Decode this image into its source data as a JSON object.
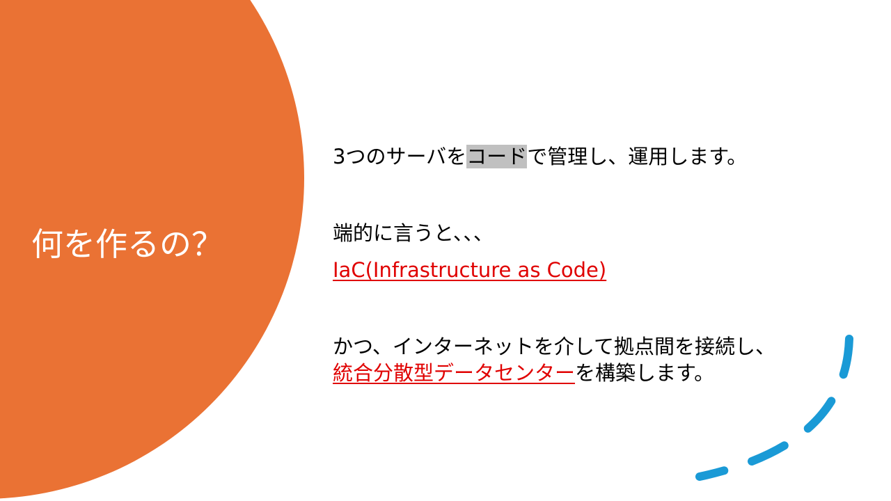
{
  "colors": {
    "circle": "#ea7234",
    "title_text": "#ffffff",
    "body_text": "#000000",
    "link_text": "#e00000",
    "highlight": "#c0c0c0",
    "dash_arc": "#1a9ad6"
  },
  "title": "何を作るの？",
  "line1": {
    "before": "3つのサーバを",
    "highlighted": "コード",
    "after": "で管理し、運用します。"
  },
  "line2": "端的に言うと、、、",
  "line3_link": "IaC(Infrastructure as Code)",
  "line4": "かつ、インターネットを介して拠点間を接続し、",
  "line5": {
    "link": "統合分散型データセンター",
    "after": "を構築します。"
  },
  "decoration": {
    "big_circle": "circle",
    "dash_arc": "dashed-arc"
  }
}
